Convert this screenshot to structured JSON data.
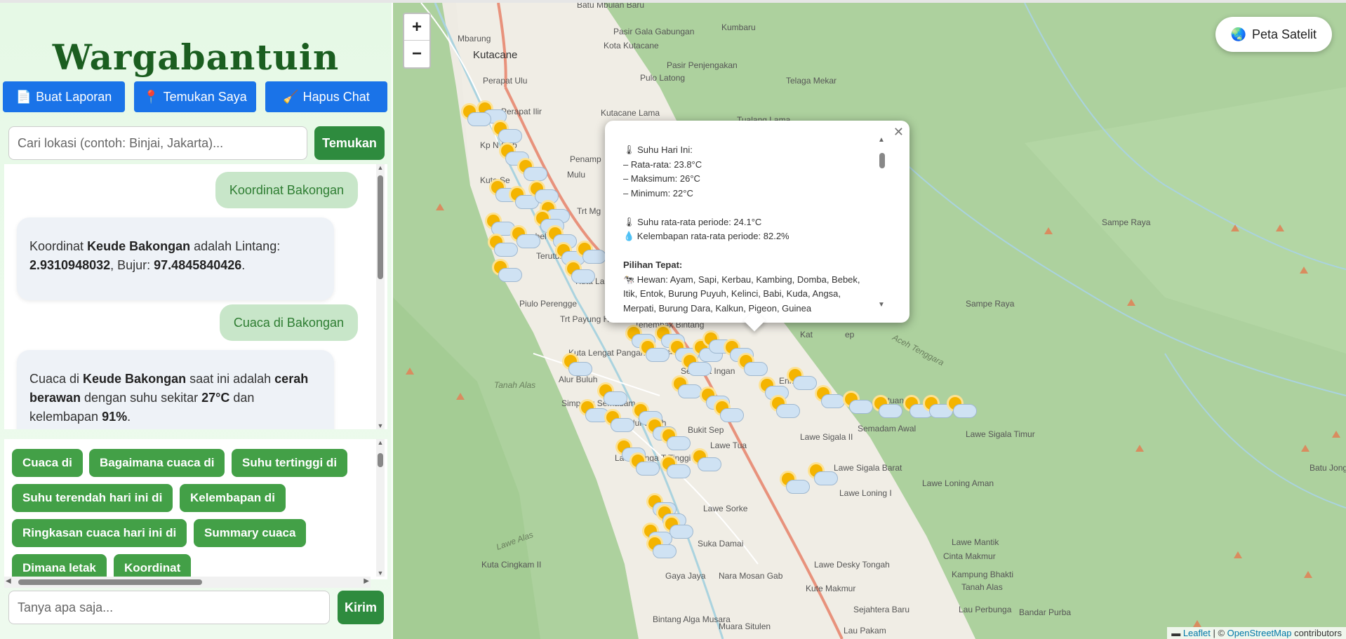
{
  "app": {
    "title": "Wargabantuin"
  },
  "actions": [
    {
      "icon": "📄",
      "label": "Buat Laporan"
    },
    {
      "icon": "📍",
      "label": "Temukan Saya"
    },
    {
      "icon": "🧹",
      "label": "Hapus Chat"
    }
  ],
  "search": {
    "placeholder": "Cari lokasi (contoh: Binjai, Jakarta)...",
    "button": "Temukan"
  },
  "chat": {
    "m1": {
      "text": "Koordinat Bakongan"
    },
    "m2": {
      "p1": "Koordinat ",
      "b1": "Keude Bakongan",
      "p2": " adalah Lintang: ",
      "b2": "2.9310948032",
      "p3": ", Bujur: ",
      "b3": "97.4845840426",
      "p4": "."
    },
    "m3": {
      "text": "Cuaca di Bakongan"
    },
    "m4": {
      "p1": "Cuaca di ",
      "b1": "Keude Bakongan",
      "p2": " saat ini adalah ",
      "b2": "cerah berawan",
      "p3": " dengan suhu sekitar ",
      "b3": "27°C",
      "p4": " dan kelembapan ",
      "b4": "91%",
      "p5": "."
    }
  },
  "chips": [
    "Cuaca di",
    "Bagaimana cuaca di",
    "Suhu tertinggi di",
    "Suhu terendah hari ini di",
    "Kelembapan di",
    "Ringkasan cuaca hari ini di",
    "Summary cuaca",
    "Dimana letak",
    "Koordinat"
  ],
  "ask": {
    "placeholder": "Tanya apa saja...",
    "button": "Kirim"
  },
  "map": {
    "zoom_in": "+",
    "zoom_out": "−",
    "satellite": {
      "icon": "🌏",
      "label": "Peta Satelit"
    },
    "popup": {
      "l1": "🌡 Suhu Hari Ini:",
      "l2": "– Rata-rata: 23.8°C",
      "l3": "– Maksimum: 26°C",
      "l4": "– Minimum: 22°C",
      "l5": "🌡 Suhu rata-rata periode: 24.1°C",
      "l6": "💧 Kelembapan rata-rata periode: 82.2%",
      "l7": "Pilihan Tepat:",
      "l8": "🐄 Hewan: Ayam, Sapi, Kerbau, Kambing, Domba, Bebek, Itik, Entok, Burung Puyuh, Kelinci, Babi, Kuda, Angsa, Merpati, Burung Dara, Kalkun, Pigeon, Guinea"
    },
    "attribution": {
      "leaflet": "Leaflet",
      "sep": " | © ",
      "osm": "OpenStreetMap",
      "tail": " contributors"
    },
    "places": [
      "Batu Mbulan Baru",
      "Pasir Gala Gabungan",
      "Kumbaru",
      "Kota Kutacane",
      "Mbarung",
      "Kutacane",
      "Pasir Penjengakan",
      "Perapat Ulu",
      "Pulo Latong",
      "Telaga Mekar",
      "Kutacane Lama",
      "Perapat Ilir",
      "Tualang Lama",
      "Kp N Gab",
      "Kute Se",
      "Penamp",
      "Mulu",
      "Trt Mg",
      "Kumbel I",
      "Terutung M Asli",
      "Kuta La",
      "Piulo Perengge",
      "Trt Payung Hilir",
      "Tenembak Bintang",
      "Maha Sing",
      "Selamat Ingan",
      "Kuta Lengat Pangan",
      "Alur Buluh",
      "Tanah Alas",
      "Simpang Semadam",
      "Ngk Alur Buluh",
      "Bukit Sep",
      "Lawe Tua",
      "Lawe Kinga T Tinggi",
      "Lawe Sorke",
      "Suka Damai",
      "Kuta Cingkam II",
      "Gaya Jaya",
      "Nara Mosan Gab",
      "Lawe Desky Tongah",
      "Kute Makmur",
      "Bintang Alga Musara",
      "Muara Situlen",
      "Lau Pakam",
      "Sejahtera Baru",
      "Lawe Sigala II",
      "Lawe Sigala Barat",
      "Lawe Loning I",
      "Lawe Loning Aman",
      "Lawe Sigala Timur",
      "Lawe Mantik",
      "Cinta Makmur",
      "Kampung Bhakti",
      "Tanah Alas",
      "Lau Perbunga",
      "Bandar Purba",
      "Semadam Awal",
      "Aceh Tenggara",
      "Sampe Raya",
      "Sampe Raya",
      "Batu Jong",
      "Lawe Alas",
      "Enm",
      "Kat",
      "ep",
      "Batuan"
    ]
  }
}
